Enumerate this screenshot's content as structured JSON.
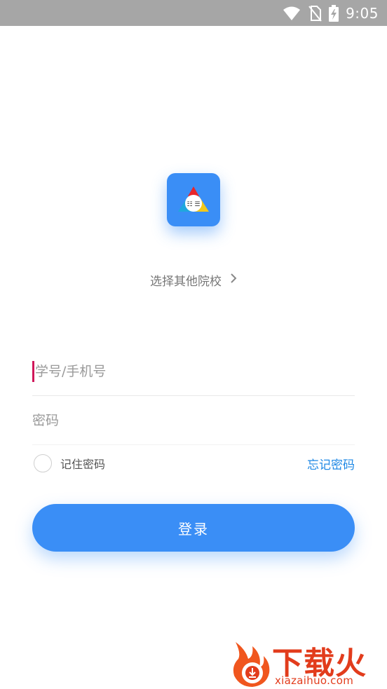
{
  "status_bar": {
    "time": "9:05",
    "icons": [
      "wifi-icon",
      "no-sim-icon",
      "battery-charging-icon"
    ]
  },
  "logo": {
    "icon": "triangle-logo-icon",
    "colors": {
      "background": "#3a8ef6",
      "red": "#e8262b",
      "yellow": "#f2c81a",
      "cyan": "#1fa7de"
    }
  },
  "school_select": {
    "label": "选择其他院校",
    "icon": "chevron-right-icon"
  },
  "form": {
    "username_placeholder": "学号/手机号",
    "password_placeholder": "密码",
    "remember_label": "记住密码",
    "forgot_label": "忘记密码",
    "login_label": "登录"
  },
  "watermark": {
    "text": "下载火",
    "url": "xiazaihuo.com",
    "icon": "fire-download-icon"
  },
  "colors": {
    "primary": "#3a8ef6",
    "link": "#1e88e5",
    "cursor": "#d0175a",
    "status_bar": "#a6a6a6"
  }
}
